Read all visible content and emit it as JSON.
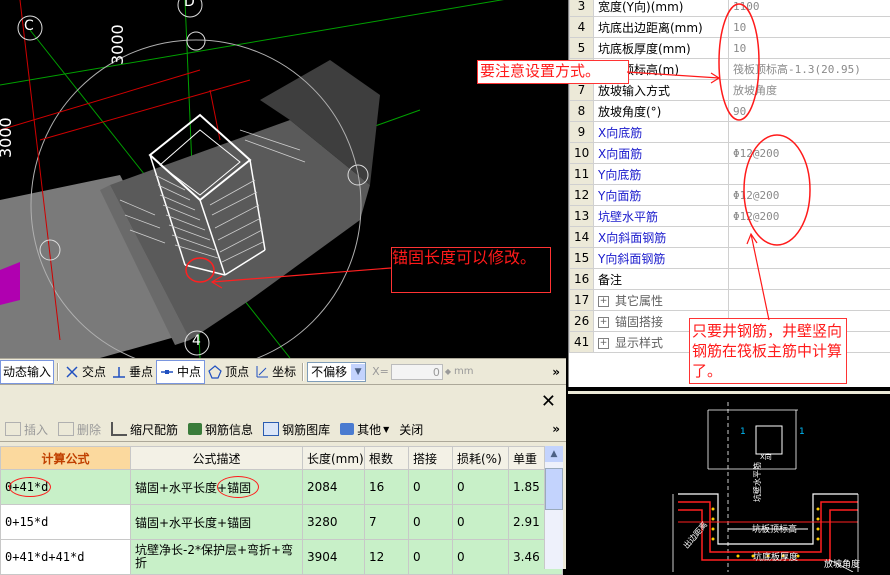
{
  "viewport": {
    "axis_c": "C",
    "axis_d": "D",
    "axis_4": "4",
    "dim_vertical": "3000",
    "dim_left": "3000",
    "callout_anchor": "锚固长度可以修改。"
  },
  "snap_toolbar": {
    "dynamic_input": "动态输入",
    "intersection": "交点",
    "perpendicular": "垂点",
    "midpoint": "中点",
    "vertex": "顶点",
    "coordinate": "坐标",
    "offset_mode": "不偏移",
    "x_label": "X=",
    "x_value": "0",
    "unit": "mm"
  },
  "rebar_toolbar": {
    "insert": "插入",
    "delete": "删除",
    "scale_rebar": "缩尺配筋",
    "rebar_info": "钢筋信息",
    "rebar_library": "钢筋图库",
    "other": "其他",
    "close": "关闭"
  },
  "rebar_table": {
    "headers": [
      "计算公式",
      "公式描述",
      "长度(mm)",
      "根数",
      "搭接",
      "损耗(%)",
      "单重"
    ],
    "rows": [
      {
        "formula": "0+41*d",
        "desc": "锚固+水平长度+锚固",
        "length": "2084",
        "count": "16",
        "lap": "0",
        "loss": "0",
        "weight": "1.85"
      },
      {
        "formula": "0+15*d",
        "desc": "锚固+水平长度+锚固",
        "length": "3280",
        "count": "7",
        "lap": "0",
        "loss": "0",
        "weight": "2.91"
      },
      {
        "formula": "0+41*d+41*d",
        "desc": "坑壁净长-2*保护层+弯折+弯折",
        "length": "3904",
        "count": "12",
        "lap": "0",
        "loss": "0",
        "weight": "3.46"
      }
    ]
  },
  "properties": {
    "rows": [
      {
        "num": "3",
        "name": "宽度(Y向)(mm)",
        "value": "1100",
        "blue": false
      },
      {
        "num": "4",
        "name": "坑底出边距离(mm)",
        "value": "10",
        "blue": false
      },
      {
        "num": "5",
        "name": "坑底板厚度(mm)",
        "value": "10",
        "blue": false
      },
      {
        "num": "6",
        "name": "坑板顶标高(m)",
        "value": "筏板顶标高-1.3(20.95)",
        "blue": false
      },
      {
        "num": "7",
        "name": "放坡输入方式",
        "value": "放坡角度",
        "blue": false
      },
      {
        "num": "8",
        "name": "放坡角度(°)",
        "value": "90",
        "blue": false
      },
      {
        "num": "9",
        "name": "X向底筋",
        "value": "",
        "blue": true
      },
      {
        "num": "10",
        "name": "X向面筋",
        "value": "Φ12@200",
        "blue": true
      },
      {
        "num": "11",
        "name": "Y向底筋",
        "value": "",
        "blue": true
      },
      {
        "num": "12",
        "name": "Y向面筋",
        "value": "Φ12@200",
        "blue": true
      },
      {
        "num": "13",
        "name": "坑壁水平筋",
        "value": "Φ12@200",
        "blue": true
      },
      {
        "num": "14",
        "name": "X向斜面钢筋",
        "value": "",
        "blue": true
      },
      {
        "num": "15",
        "name": "Y向斜面钢筋",
        "value": "",
        "blue": true
      },
      {
        "num": "16",
        "name": "备注",
        "value": "",
        "blue": false
      }
    ],
    "groups": [
      {
        "num": "17",
        "name": "其它属性"
      },
      {
        "num": "26",
        "name": "锚固搭接"
      },
      {
        "num": "41",
        "name": "显示样式"
      }
    ]
  },
  "annotations": {
    "note_setting": "要注意设置方式。",
    "note_rebar": "只要井钢筋，井壁竖向钢筋在筏板主筋中计算了。"
  },
  "preview": {
    "dim_1a": "1",
    "dim_1b": "1",
    "label_x": "X向",
    "label_wall": "坑壁水平筋",
    "label_top": "坑板顶标高",
    "label_thick": "坑底板厚度",
    "label_slope": "放坡角度",
    "label_edge": "出边距离"
  },
  "colors": {
    "annotation_red": "#ff1a1a",
    "selected_row": "#c8f0c8",
    "blue_text": "#1a1acc"
  }
}
